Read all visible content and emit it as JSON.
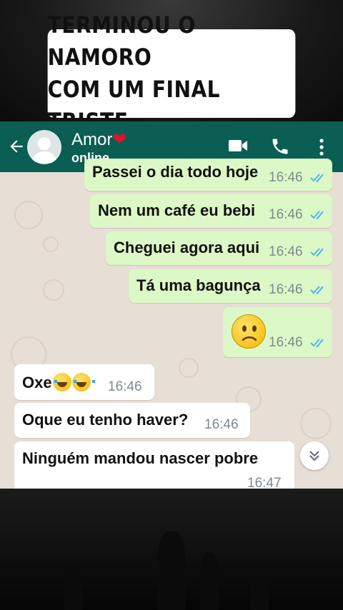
{
  "caption": {
    "line1": "TERMINOU O NAMORO",
    "line2": "COM UM FINAL TRISTE"
  },
  "header": {
    "contact_name": "Amor",
    "heart_emoji": "❤",
    "status": "online",
    "back_icon": "arrow-left-icon",
    "video_icon": "video-camera-icon",
    "call_icon": "phone-icon",
    "menu_icon": "more-vertical-icon",
    "color": "#0a5e54"
  },
  "messages": [
    {
      "direction": "out",
      "text": "Passei o dia todo hoje",
      "time": "16:46"
    },
    {
      "direction": "out",
      "text": "Nem um café eu bebi",
      "time": "16:46"
    },
    {
      "direction": "out",
      "text": "Cheguei agora aqui",
      "time": "16:46"
    },
    {
      "direction": "out",
      "text": "Tá uma bagunça",
      "time": "16:46"
    },
    {
      "direction": "out",
      "text": "",
      "emoji": "slightly-frowning-face",
      "time": "16:46"
    },
    {
      "direction": "in",
      "text": "Oxe",
      "emoji": "face-with-tears-of-joy x2",
      "time": "16:46"
    },
    {
      "direction": "in",
      "text": "Oque eu tenho haver?",
      "time": "16:46"
    },
    {
      "direction": "in",
      "text": "Ninguém mandou nascer pobre",
      "time": "16:47"
    }
  ],
  "scroll_button_icon": "chevron-double-down-icon",
  "colors": {
    "outgoing_bubble": "#dcf8c6",
    "incoming_bubble": "#ffffff",
    "read_ticks": "#4fb6ec",
    "chat_bg": "#e7ded6"
  }
}
